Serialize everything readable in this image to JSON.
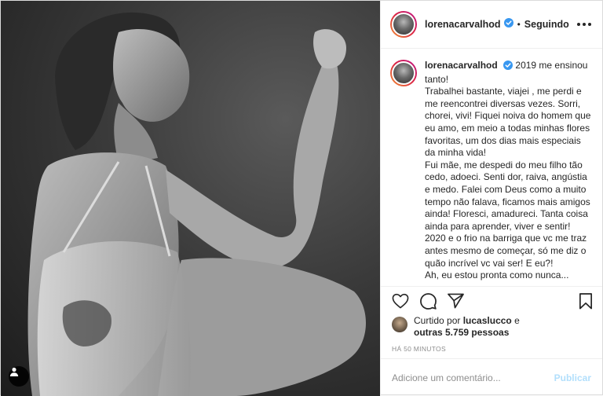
{
  "post": {
    "photo": {
      "alt_icon": "person-icon"
    },
    "header": {
      "username": "lorenacarvalhod",
      "verified_icon": "verified-badge-icon",
      "separator": "•",
      "follow_status": "Seguindo",
      "more_icon": "more-options-icon"
    },
    "caption": {
      "username": "lorenacarvalhod",
      "paragraphs": [
        "2019 me ensinou tanto!",
        "Trabalhei bastante, viajei , me perdi e me reencontrei diversas vezes. Sorri, chorei, vivi! Fiquei noiva do homem que eu amo, em meio a todas minhas flores favoritas, um dos dias mais especiais da minha vida!",
        "Fui mãe, me despedi do meu filho tão cedo, adoeci. Senti dor, raiva, angústia e medo. Falei com Deus como a muito tempo não falava, ficamos mais amigos ainda! Floresci, amadureci. Tanta coisa ainda para aprender, viver e sentir!",
        "2020 e o frio na barriga que vc me traz antes mesmo de começar, só me diz o quão incrível vc vai ser! E eu?!",
        "Ah, eu estou pronta como nunca..."
      ]
    },
    "actions": {
      "like_icon": "heart-icon",
      "comment_icon": "comment-icon",
      "share_icon": "share-icon",
      "save_icon": "bookmark-icon"
    },
    "likes": {
      "prefix": "Curtido por",
      "liker": "lucaslucco",
      "conjunction": "e",
      "others": "outras 5.759 pessoas"
    },
    "timestamp": "HÁ 50 MINUTOS",
    "comment": {
      "placeholder": "Adicione um comentário...",
      "publish_label": "Publicar"
    },
    "colors": {
      "accent": "#0095f6",
      "publish_disabled": "#b2dffc",
      "verified": "#3897f0",
      "border": "#dbdbdb"
    }
  }
}
